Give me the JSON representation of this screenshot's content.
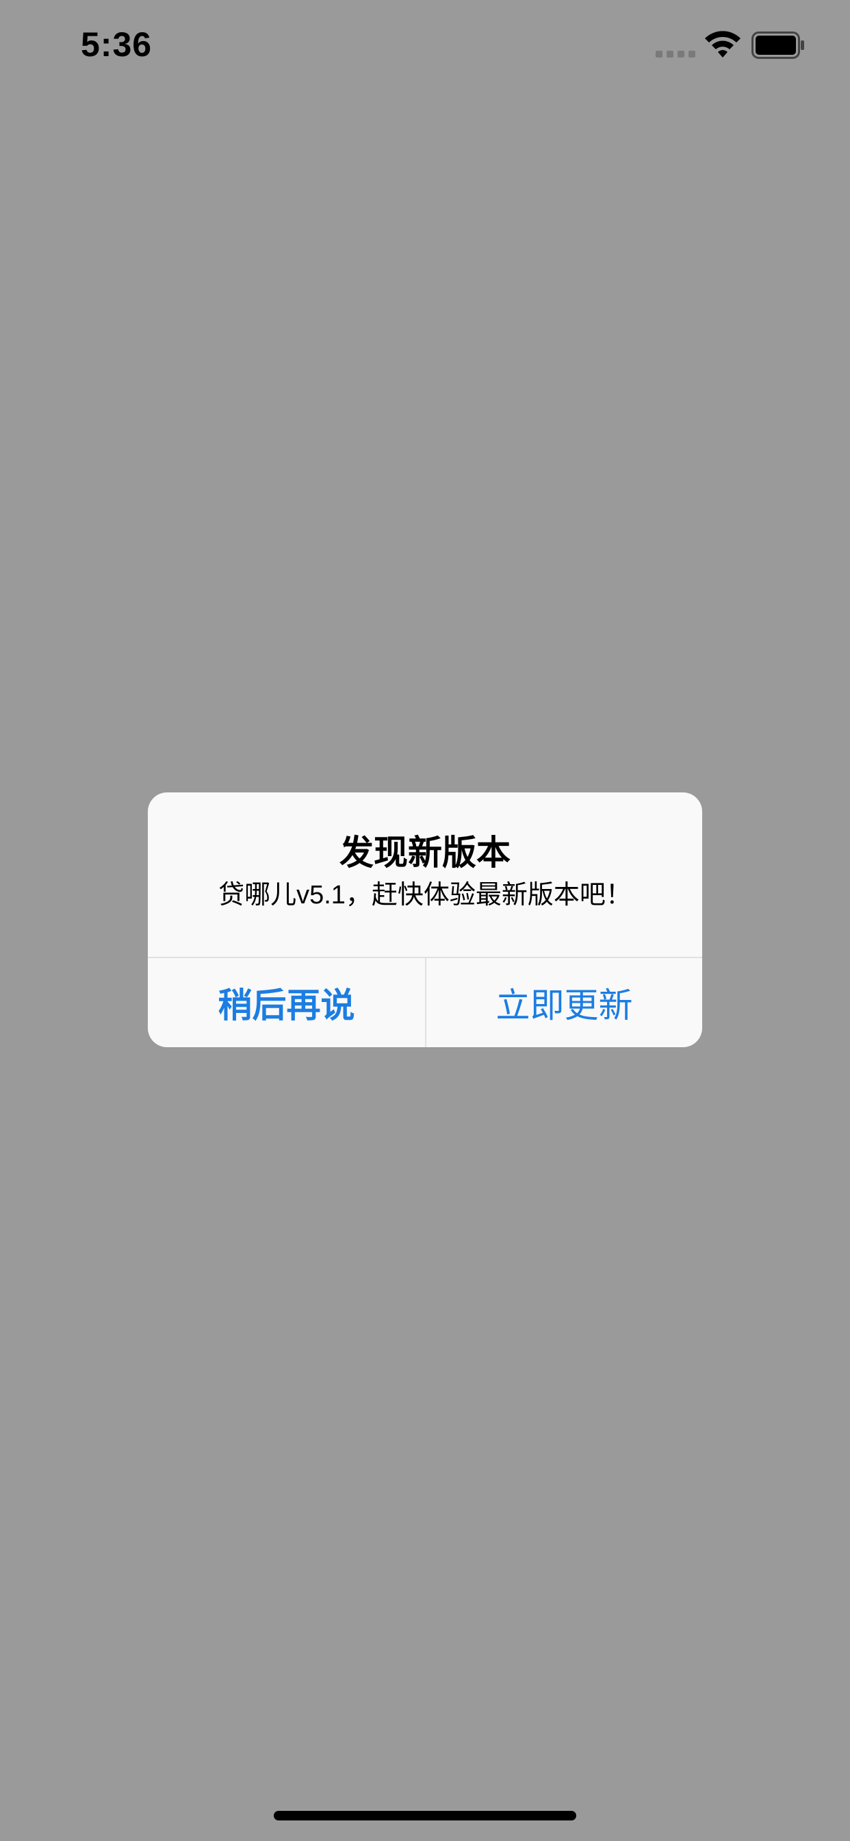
{
  "status_bar": {
    "time": "5:36",
    "icons": [
      "signal-icon",
      "wifi-icon",
      "battery-icon"
    ]
  },
  "alert": {
    "title": "发现新版本",
    "message": "贷哪儿v5.1，赶快体验最新版本吧！",
    "buttons": [
      {
        "label": "稍后再说",
        "style": "bold"
      },
      {
        "label": "立即更新",
        "style": "regular"
      }
    ],
    "button_color": "#1b7de2"
  },
  "colors": {
    "backdrop": "#9a9a9a",
    "alert_background": "#f9f9f9"
  }
}
